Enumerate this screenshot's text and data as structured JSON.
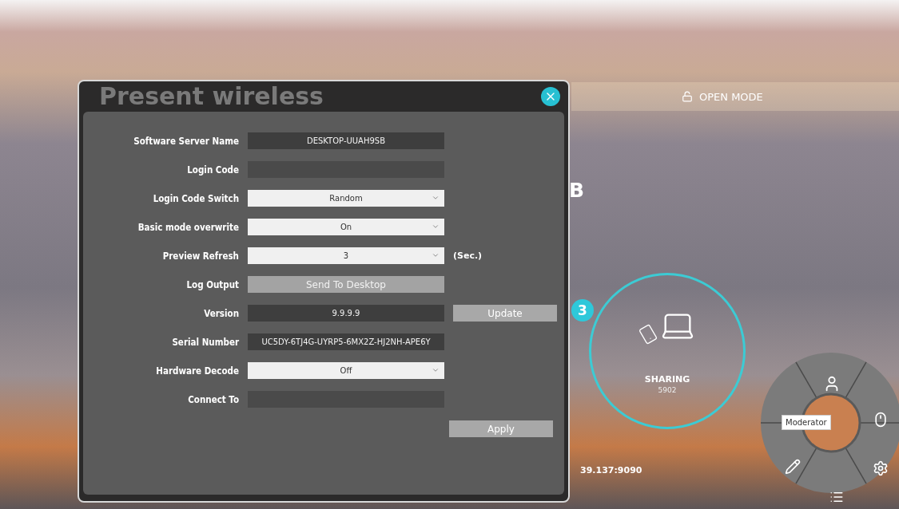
{
  "dialog": {
    "title": "Present wireless",
    "fields": [
      {
        "label": "Software Server Name",
        "kind": "readonly",
        "value": "DESKTOP-UUAH9SB"
      },
      {
        "label": "Login Code",
        "kind": "input"
      },
      {
        "label": "Login Code Switch",
        "kind": "select",
        "value": "Random"
      },
      {
        "label": "Basic mode overwrite",
        "kind": "select",
        "value": "On"
      },
      {
        "label": "Preview Refresh",
        "kind": "select",
        "value": "3",
        "unit": "(Sec.)"
      },
      {
        "label": "Log Output",
        "kind": "button",
        "value": "Send To Desktop"
      },
      {
        "label": "Version",
        "kind": "readonly",
        "value": "9.9.9.9",
        "action": "Update"
      },
      {
        "label": "Serial Number",
        "kind": "readonly",
        "value": "UC5DY-6TJ4G-UYRP5-6MX2Z-HJ2NH-APE6Y"
      },
      {
        "label": "Hardware Decode",
        "kind": "select",
        "value": "Off"
      },
      {
        "label": "Connect To",
        "kind": "input"
      }
    ],
    "apply": "Apply"
  },
  "mode_bar": {
    "label": "OPEN MODE"
  },
  "host_name_visible": "B",
  "address_visible": "39.137:9090",
  "sharing": {
    "badge": "3",
    "label": "SHARING",
    "code": "5902"
  },
  "radial_menu": {
    "tooltip": "Moderator"
  }
}
